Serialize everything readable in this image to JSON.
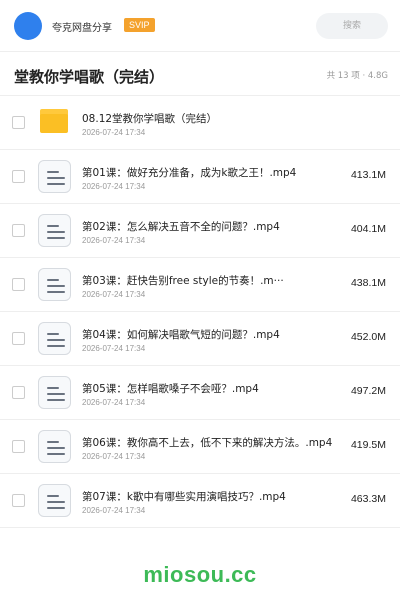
{
  "header": {
    "app_name": "夸克网盘分享",
    "badge": "SVIP",
    "search_placeholder": "搜索"
  },
  "folder": {
    "title": "堂教你学唱歌（完结）",
    "meta": "共 13 项 · 4.8G"
  },
  "files": [
    {
      "name": "08.12堂教你学唱歌（完结）",
      "date": "2026-07-24 17:34",
      "size": "",
      "type": "folder"
    },
    {
      "name": "第01课：做好充分准备，成为k歌之王！.mp4",
      "date": "2026-07-24 17:34",
      "size": "413.1M",
      "type": "video"
    },
    {
      "name": "第02课：怎么解决五音不全的问题？.mp4",
      "date": "2026-07-24 17:34",
      "size": "404.1M",
      "type": "video"
    },
    {
      "name": "第03课：赶快告别free style的节奏！.m···",
      "date": "2026-07-24 17:34",
      "size": "438.1M",
      "type": "video"
    },
    {
      "name": "第04课：如何解决唱歌气短的问题？.mp4",
      "date": "2026-07-24 17:34",
      "size": "452.0M",
      "type": "video"
    },
    {
      "name": "第05课：怎样唱歌嗓子不会哑？.mp4",
      "date": "2026-07-24 17:34",
      "size": "497.2M",
      "type": "video"
    },
    {
      "name": "第06课：教你高不上去，低不下来的解决方法。.mp4",
      "date": "2026-07-24 17:34",
      "size": "419.5M",
      "type": "video"
    },
    {
      "name": "第07课：k歌中有哪些实用演唱技巧？.mp4",
      "date": "2026-07-24 17:34",
      "size": "463.3M",
      "type": "video"
    }
  ],
  "watermark": "miosou.cc",
  "colors": {
    "avatar": "#2f80ed",
    "svip_badge": "#f4a22d",
    "folder_icon": "#fbbf24",
    "watermark": "#3dba57"
  }
}
